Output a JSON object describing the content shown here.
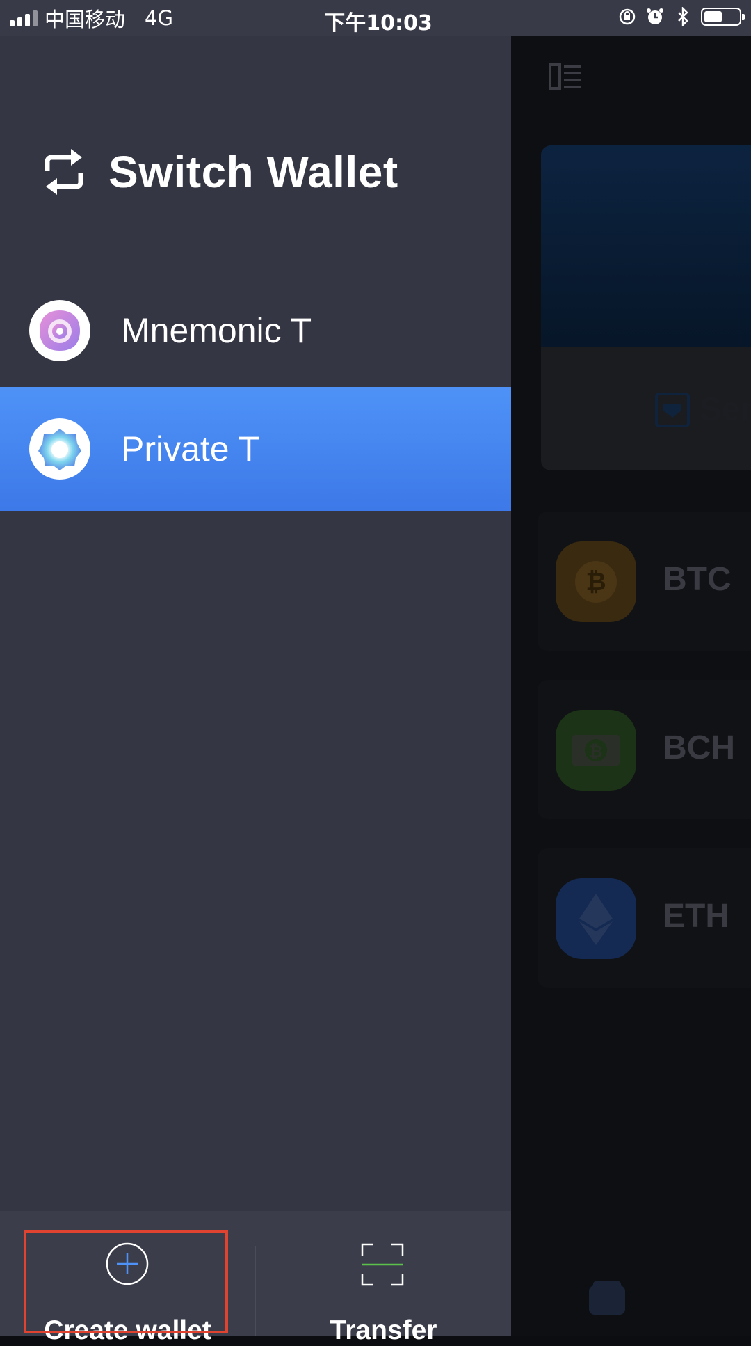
{
  "status_bar": {
    "carrier": "中国移动",
    "network": "4G",
    "time": "下午10:03",
    "icons": [
      "signal-icon",
      "orientation-lock-icon",
      "alarm-icon",
      "bluetooth-icon",
      "battery-icon"
    ]
  },
  "drawer": {
    "title": "Switch Wallet",
    "title_icon": "switch-arrows-icon",
    "wallets": [
      {
        "name": "Mnemonic T",
        "icon": "mnemonic-wallet-avatar",
        "active": false
      },
      {
        "name": "Private T",
        "icon": "private-wallet-avatar",
        "active": true
      }
    ],
    "bottom": {
      "create_label": "Create wallet",
      "transfer_label": "Transfer"
    }
  },
  "background_app": {
    "send_label": "Sen",
    "coins": [
      {
        "symbol": "BTC",
        "icon": "bitcoin-icon",
        "color": "#f7931a"
      },
      {
        "symbol": "BCH",
        "icon": "bitcoin-cash-icon",
        "color": "#4cc947"
      },
      {
        "symbol": "ETH",
        "icon": "ethereum-icon",
        "color": "#3c6fe0"
      }
    ]
  },
  "colors": {
    "drawer_bg": "#353643",
    "active_item": "#4a8cf5",
    "highlight_border": "#e0432f"
  }
}
